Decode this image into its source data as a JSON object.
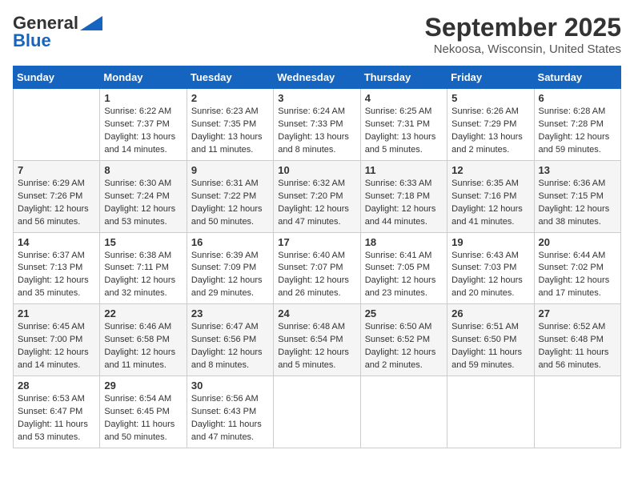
{
  "header": {
    "logo_general": "General",
    "logo_blue": "Blue",
    "month_title": "September 2025",
    "location": "Nekoosa, Wisconsin, United States"
  },
  "weekdays": [
    "Sunday",
    "Monday",
    "Tuesday",
    "Wednesday",
    "Thursday",
    "Friday",
    "Saturday"
  ],
  "weeks": [
    [
      {
        "day": "",
        "info": ""
      },
      {
        "day": "1",
        "info": "Sunrise: 6:22 AM\nSunset: 7:37 PM\nDaylight: 13 hours\nand 14 minutes."
      },
      {
        "day": "2",
        "info": "Sunrise: 6:23 AM\nSunset: 7:35 PM\nDaylight: 13 hours\nand 11 minutes."
      },
      {
        "day": "3",
        "info": "Sunrise: 6:24 AM\nSunset: 7:33 PM\nDaylight: 13 hours\nand 8 minutes."
      },
      {
        "day": "4",
        "info": "Sunrise: 6:25 AM\nSunset: 7:31 PM\nDaylight: 13 hours\nand 5 minutes."
      },
      {
        "day": "5",
        "info": "Sunrise: 6:26 AM\nSunset: 7:29 PM\nDaylight: 13 hours\nand 2 minutes."
      },
      {
        "day": "6",
        "info": "Sunrise: 6:28 AM\nSunset: 7:28 PM\nDaylight: 12 hours\nand 59 minutes."
      }
    ],
    [
      {
        "day": "7",
        "info": "Sunrise: 6:29 AM\nSunset: 7:26 PM\nDaylight: 12 hours\nand 56 minutes."
      },
      {
        "day": "8",
        "info": "Sunrise: 6:30 AM\nSunset: 7:24 PM\nDaylight: 12 hours\nand 53 minutes."
      },
      {
        "day": "9",
        "info": "Sunrise: 6:31 AM\nSunset: 7:22 PM\nDaylight: 12 hours\nand 50 minutes."
      },
      {
        "day": "10",
        "info": "Sunrise: 6:32 AM\nSunset: 7:20 PM\nDaylight: 12 hours\nand 47 minutes."
      },
      {
        "day": "11",
        "info": "Sunrise: 6:33 AM\nSunset: 7:18 PM\nDaylight: 12 hours\nand 44 minutes."
      },
      {
        "day": "12",
        "info": "Sunrise: 6:35 AM\nSunset: 7:16 PM\nDaylight: 12 hours\nand 41 minutes."
      },
      {
        "day": "13",
        "info": "Sunrise: 6:36 AM\nSunset: 7:15 PM\nDaylight: 12 hours\nand 38 minutes."
      }
    ],
    [
      {
        "day": "14",
        "info": "Sunrise: 6:37 AM\nSunset: 7:13 PM\nDaylight: 12 hours\nand 35 minutes."
      },
      {
        "day": "15",
        "info": "Sunrise: 6:38 AM\nSunset: 7:11 PM\nDaylight: 12 hours\nand 32 minutes."
      },
      {
        "day": "16",
        "info": "Sunrise: 6:39 AM\nSunset: 7:09 PM\nDaylight: 12 hours\nand 29 minutes."
      },
      {
        "day": "17",
        "info": "Sunrise: 6:40 AM\nSunset: 7:07 PM\nDaylight: 12 hours\nand 26 minutes."
      },
      {
        "day": "18",
        "info": "Sunrise: 6:41 AM\nSunset: 7:05 PM\nDaylight: 12 hours\nand 23 minutes."
      },
      {
        "day": "19",
        "info": "Sunrise: 6:43 AM\nSunset: 7:03 PM\nDaylight: 12 hours\nand 20 minutes."
      },
      {
        "day": "20",
        "info": "Sunrise: 6:44 AM\nSunset: 7:02 PM\nDaylight: 12 hours\nand 17 minutes."
      }
    ],
    [
      {
        "day": "21",
        "info": "Sunrise: 6:45 AM\nSunset: 7:00 PM\nDaylight: 12 hours\nand 14 minutes."
      },
      {
        "day": "22",
        "info": "Sunrise: 6:46 AM\nSunset: 6:58 PM\nDaylight: 12 hours\nand 11 minutes."
      },
      {
        "day": "23",
        "info": "Sunrise: 6:47 AM\nSunset: 6:56 PM\nDaylight: 12 hours\nand 8 minutes."
      },
      {
        "day": "24",
        "info": "Sunrise: 6:48 AM\nSunset: 6:54 PM\nDaylight: 12 hours\nand 5 minutes."
      },
      {
        "day": "25",
        "info": "Sunrise: 6:50 AM\nSunset: 6:52 PM\nDaylight: 12 hours\nand 2 minutes."
      },
      {
        "day": "26",
        "info": "Sunrise: 6:51 AM\nSunset: 6:50 PM\nDaylight: 11 hours\nand 59 minutes."
      },
      {
        "day": "27",
        "info": "Sunrise: 6:52 AM\nSunset: 6:48 PM\nDaylight: 11 hours\nand 56 minutes."
      }
    ],
    [
      {
        "day": "28",
        "info": "Sunrise: 6:53 AM\nSunset: 6:47 PM\nDaylight: 11 hours\nand 53 minutes."
      },
      {
        "day": "29",
        "info": "Sunrise: 6:54 AM\nSunset: 6:45 PM\nDaylight: 11 hours\nand 50 minutes."
      },
      {
        "day": "30",
        "info": "Sunrise: 6:56 AM\nSunset: 6:43 PM\nDaylight: 11 hours\nand 47 minutes."
      },
      {
        "day": "",
        "info": ""
      },
      {
        "day": "",
        "info": ""
      },
      {
        "day": "",
        "info": ""
      },
      {
        "day": "",
        "info": ""
      }
    ]
  ]
}
